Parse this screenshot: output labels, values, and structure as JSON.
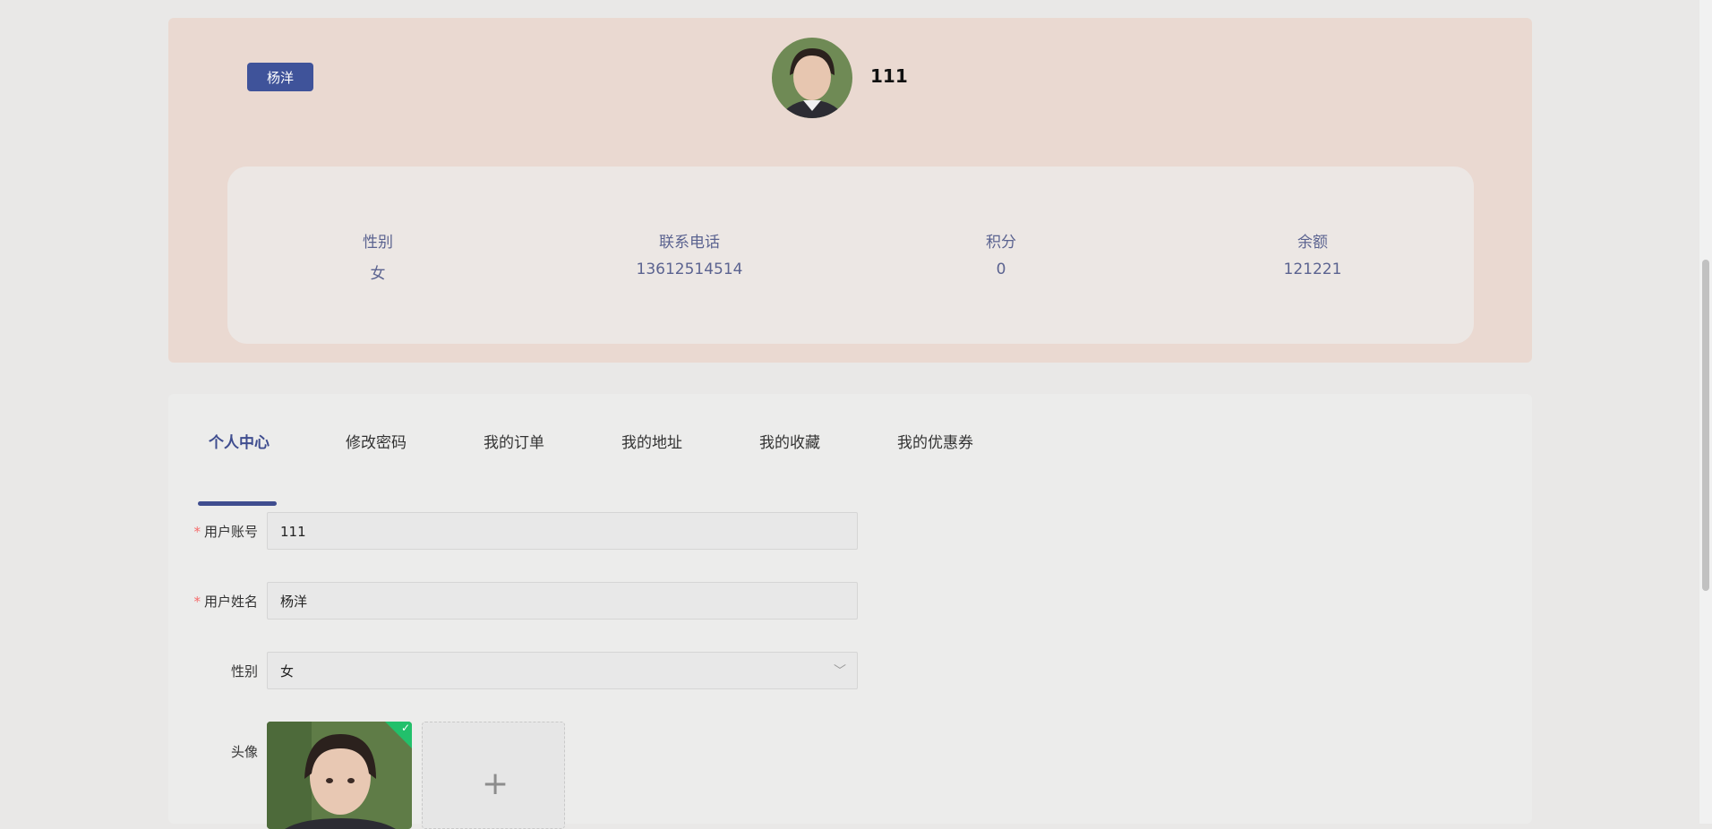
{
  "header": {
    "user_badge": "杨洋",
    "account": "111"
  },
  "stats": [
    {
      "label": "性别",
      "value": "女"
    },
    {
      "label": "联系电话",
      "value": "13612514514"
    },
    {
      "label": "积分",
      "value": "0"
    },
    {
      "label": "余额",
      "value": "121221"
    }
  ],
  "tabs": [
    {
      "label": "个人中心",
      "active": true
    },
    {
      "label": "修改密码",
      "active": false
    },
    {
      "label": "我的订单",
      "active": false
    },
    {
      "label": "我的地址",
      "active": false
    },
    {
      "label": "我的收藏",
      "active": false
    },
    {
      "label": "我的优惠券",
      "active": false
    }
  ],
  "form": {
    "required_mark": "*",
    "account_label": "用户账号",
    "account_value": "111",
    "name_label": "用户姓名",
    "name_value": "杨洋",
    "gender_label": "性别",
    "gender_value": "女",
    "avatar_label": "头像",
    "upload_plus": "+",
    "upload_ok": "✓",
    "chevron": "﹀"
  },
  "colors": {
    "accent": "#3f539a",
    "header_bg": "#ead9d1",
    "success": "#22c06b",
    "required": "#f56c6c"
  }
}
